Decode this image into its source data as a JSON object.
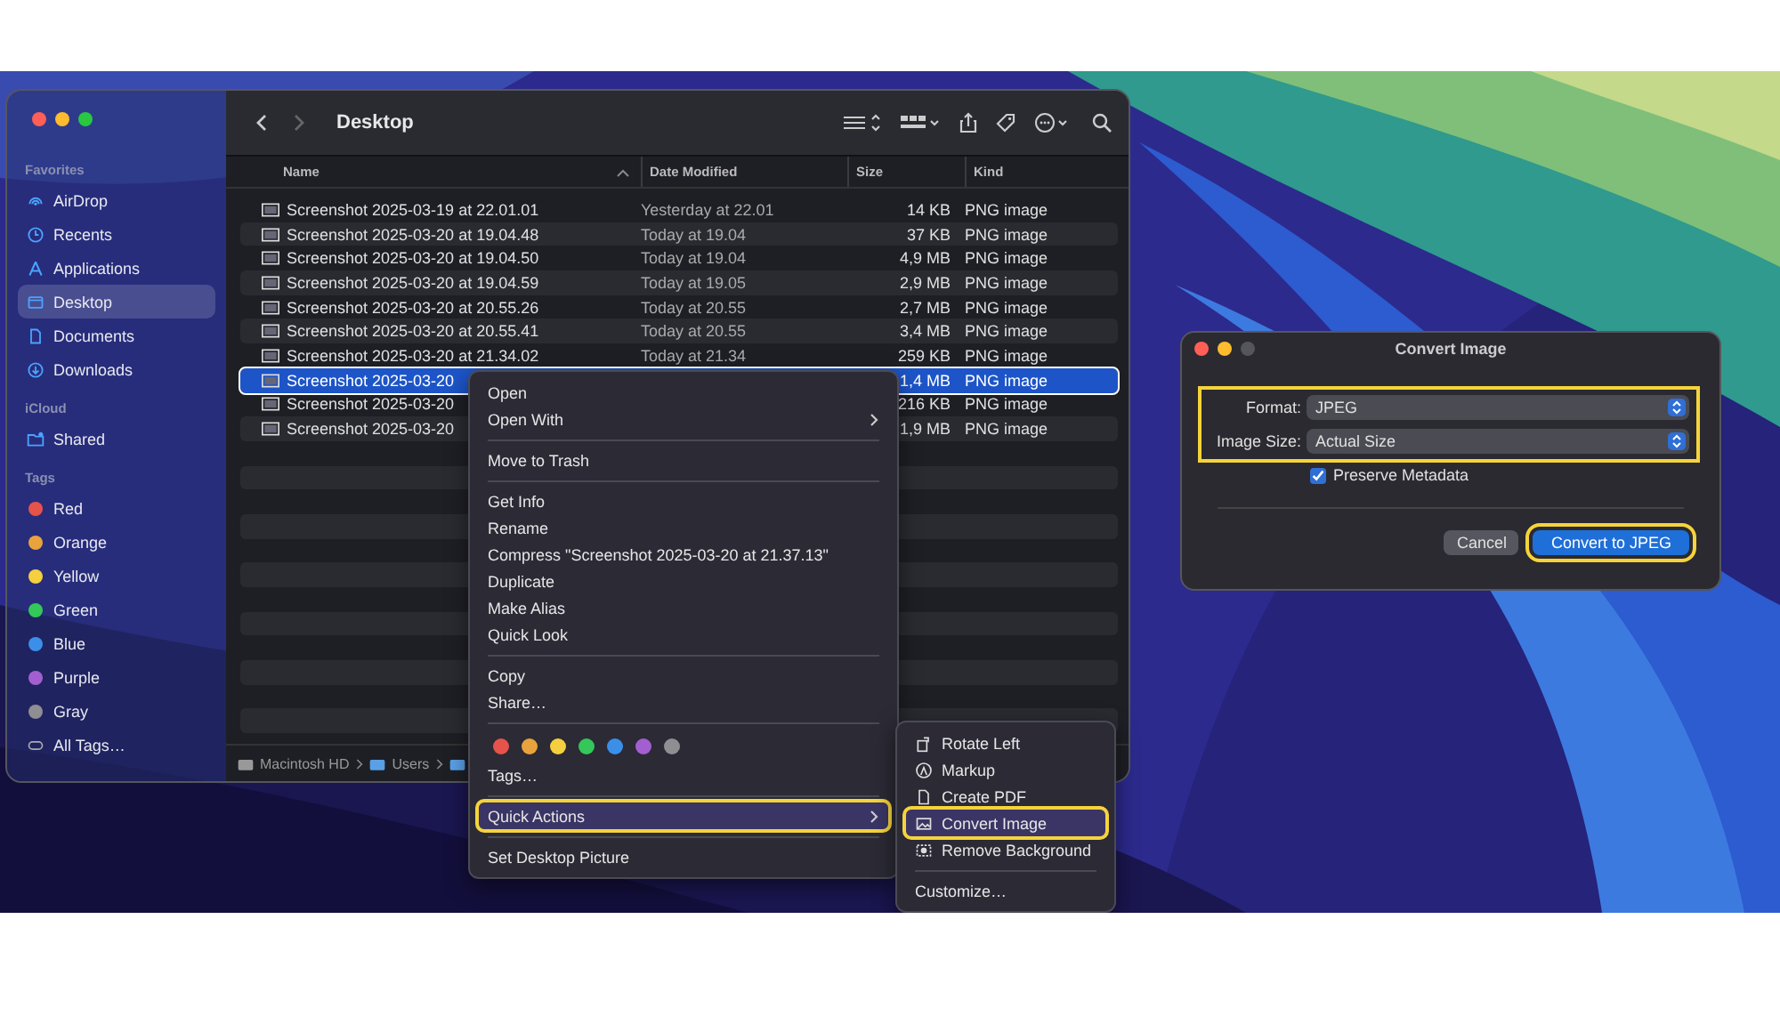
{
  "finder": {
    "title": "Desktop",
    "sidebar": [
      {
        "heading": "Favorites",
        "items": [
          {
            "label": "AirDrop",
            "selected": false
          },
          {
            "label": "Recents",
            "selected": false
          },
          {
            "label": "Applications",
            "selected": false
          },
          {
            "label": "Desktop",
            "selected": true
          },
          {
            "label": "Documents",
            "selected": false
          },
          {
            "label": "Downloads",
            "selected": false
          }
        ]
      },
      {
        "heading": "iCloud",
        "items": [
          {
            "label": "Shared",
            "selected": false
          }
        ]
      },
      {
        "heading": "Tags",
        "items": [
          {
            "label": "Red",
            "color": "#e5534b"
          },
          {
            "label": "Orange",
            "color": "#e8a33d"
          },
          {
            "label": "Yellow",
            "color": "#f4d03f"
          },
          {
            "label": "Green",
            "color": "#34c759"
          },
          {
            "label": "Blue",
            "color": "#3b8fe8"
          },
          {
            "label": "Purple",
            "color": "#a35fd0"
          },
          {
            "label": "Gray",
            "color": "#8e8e93"
          },
          {
            "label": "All Tags…"
          }
        ]
      }
    ],
    "columns": [
      {
        "label": "Name",
        "sorted": true
      },
      {
        "label": "Date Modified",
        "sorted": false
      },
      {
        "label": "Size",
        "sorted": false
      },
      {
        "label": "Kind",
        "sorted": false
      }
    ],
    "rows": [
      {
        "name": "Screenshot 2025-03-19 at 22.01.01",
        "date": "Yesterday at 22.01",
        "size": "14 KB",
        "kind": "PNG image",
        "selected": false
      },
      {
        "name": "Screenshot 2025-03-20 at 19.04.48",
        "date": "Today at 19.04",
        "size": "37 KB",
        "kind": "PNG image",
        "selected": false
      },
      {
        "name": "Screenshot 2025-03-20 at 19.04.50",
        "date": "Today at 19.04",
        "size": "4,9 MB",
        "kind": "PNG image",
        "selected": false
      },
      {
        "name": "Screenshot 2025-03-20 at 19.04.59",
        "date": "Today at 19.05",
        "size": "2,9 MB",
        "kind": "PNG image",
        "selected": false
      },
      {
        "name": "Screenshot 2025-03-20 at 20.55.26",
        "date": "Today at 20.55",
        "size": "2,7 MB",
        "kind": "PNG image",
        "selected": false
      },
      {
        "name": "Screenshot 2025-03-20 at 20.55.41",
        "date": "Today at 20.55",
        "size": "3,4 MB",
        "kind": "PNG image",
        "selected": false
      },
      {
        "name": "Screenshot 2025-03-20 at 21.34.02",
        "date": "Today at 21.34",
        "size": "259 KB",
        "kind": "PNG image",
        "selected": false
      },
      {
        "name": "Screenshot 2025-03-20",
        "size": "1,4 MB",
        "kind": "PNG image",
        "selected": true
      },
      {
        "name": "Screenshot 2025-03-20",
        "size": "216 KB",
        "kind": "PNG image",
        "selected": false
      },
      {
        "name": "Screenshot 2025-03-20",
        "size": "1,9 MB",
        "kind": "PNG image",
        "selected": false
      }
    ],
    "path": [
      "Macintosh HD",
      "Users"
    ]
  },
  "context_menu": {
    "items": [
      {
        "kind": "item",
        "label": "Open",
        "submenu": false,
        "highlighted": false
      },
      {
        "kind": "item",
        "label": "Open With",
        "submenu": true,
        "highlighted": false
      },
      {
        "kind": "separator"
      },
      {
        "kind": "item",
        "label": "Move to Trash",
        "submenu": false,
        "highlighted": false
      },
      {
        "kind": "separator"
      },
      {
        "kind": "item",
        "label": "Get Info",
        "submenu": false,
        "highlighted": false
      },
      {
        "kind": "item",
        "label": "Rename",
        "submenu": false,
        "highlighted": false
      },
      {
        "kind": "item",
        "label": "Compress \"Screenshot 2025-03-20 at 21.37.13\"",
        "submenu": false,
        "highlighted": false
      },
      {
        "kind": "item",
        "label": "Duplicate",
        "submenu": false,
        "highlighted": false
      },
      {
        "kind": "item",
        "label": "Make Alias",
        "submenu": false,
        "highlighted": false
      },
      {
        "kind": "item",
        "label": "Quick Look",
        "submenu": false,
        "highlighted": false
      },
      {
        "kind": "separator"
      },
      {
        "kind": "item",
        "label": "Copy",
        "submenu": false,
        "highlighted": false
      },
      {
        "kind": "item",
        "label": "Share…",
        "submenu": false,
        "highlighted": false
      },
      {
        "kind": "separator"
      },
      {
        "kind": "colors",
        "colors": [
          {
            "color": "#e5534b"
          },
          {
            "color": "#e8a33d"
          },
          {
            "color": "#f4d03f"
          },
          {
            "color": "#34c759"
          },
          {
            "color": "#3b8fe8"
          },
          {
            "color": "#a35fd0"
          },
          {
            "color": "#8e8e93"
          }
        ]
      },
      {
        "kind": "item",
        "label": "Tags…",
        "submenu": false,
        "highlighted": false
      },
      {
        "kind": "separator"
      },
      {
        "kind": "item",
        "label": "Quick Actions",
        "submenu": true,
        "highlighted": true
      },
      {
        "kind": "separator"
      },
      {
        "kind": "item",
        "label": "Set Desktop Picture",
        "submenu": false,
        "highlighted": false
      }
    ]
  },
  "quick_actions": {
    "items": [
      {
        "kind": "item",
        "label": "Rotate Left",
        "highlighted": false
      },
      {
        "kind": "item",
        "label": "Markup",
        "highlighted": false
      },
      {
        "kind": "item",
        "label": "Create PDF",
        "highlighted": false
      },
      {
        "kind": "item",
        "label": "Convert Image",
        "highlighted": true
      },
      {
        "kind": "item",
        "label": "Remove Background",
        "highlighted": false
      },
      {
        "kind": "separator"
      },
      {
        "kind": "plain",
        "label": "Customize…",
        "highlighted": false
      }
    ]
  },
  "dialog": {
    "title": "Convert Image",
    "fields_highlighted": true,
    "fields": [
      {
        "label": "Format:",
        "value": "JPEG"
      },
      {
        "label": "Image Size:",
        "value": "Actual Size"
      }
    ],
    "checkbox": {
      "label": "Preserve Metadata",
      "checked": true
    },
    "buttons": [
      {
        "label": "Cancel",
        "default": false,
        "highlighted": false
      },
      {
        "label": "Convert to JPEG",
        "default": true,
        "highlighted": true
      }
    ]
  }
}
